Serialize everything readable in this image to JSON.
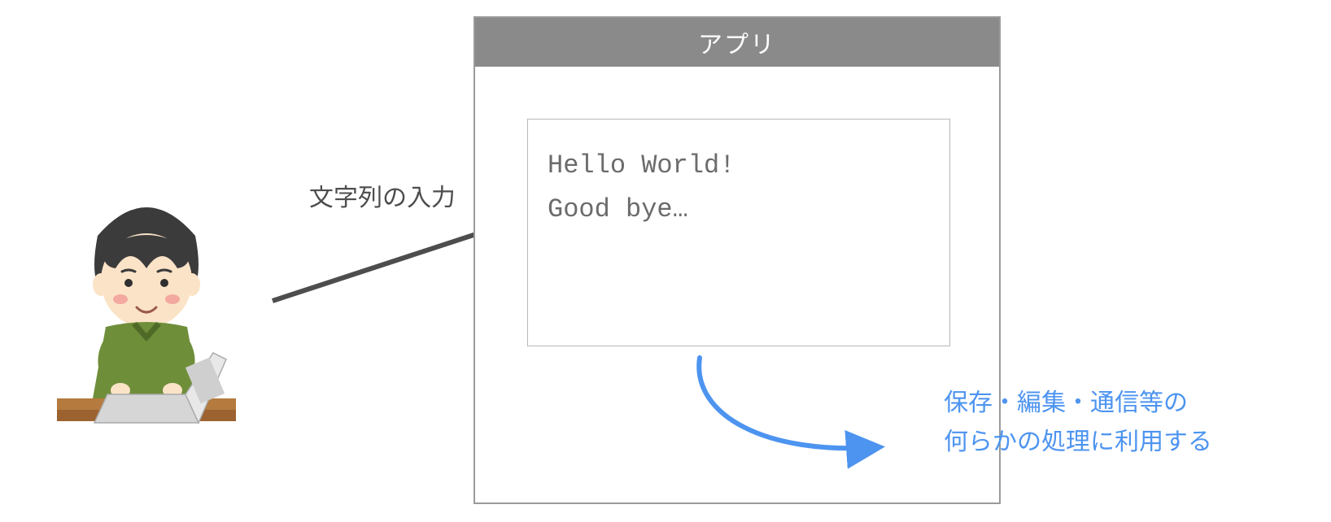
{
  "inputLabel": "文字列の入力",
  "window": {
    "title": "アプリ",
    "textContent": "Hello World!\nGood bye…"
  },
  "processLabel": {
    "line1": "保存・編集・通信等の",
    "line2": "何らかの処理に利用する"
  },
  "colors": {
    "titlebarBg": "#8a8a8a",
    "border": "#9a9a9a",
    "text": "#4d4d4d",
    "blue": "#4d94f0"
  }
}
